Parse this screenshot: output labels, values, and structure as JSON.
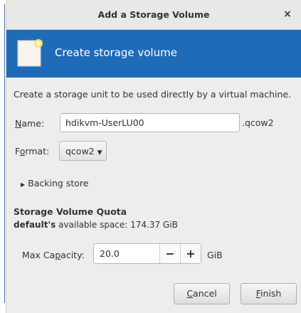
{
  "dialog": {
    "title": "Add a Storage Volume",
    "close_glyph": "×"
  },
  "banner": {
    "heading": "Create storage volume",
    "icon": "new-volume-icon",
    "color": "#1f6bb8"
  },
  "form": {
    "description": "Create a storage unit to be used directly by a virtual machine.",
    "name_label_pre": "",
    "name_label_u": "N",
    "name_label_post": "ame:",
    "name_value": "hdikvm-UserLU00",
    "name_suffix": ".qcow2",
    "format_label_pre": "F",
    "format_label_u": "o",
    "format_label_post": "rmat:",
    "format_value": "qcow2",
    "backing_store_label": "Backing store"
  },
  "quota": {
    "title": "Storage Volume Quota",
    "pool": "default's",
    "available_text": "available space: 174.37 GiB",
    "max_capacity_label_pre": "Max Ca",
    "max_capacity_label_u": "p",
    "max_capacity_label_post": "acity:",
    "max_capacity_value": "20.0",
    "decrement": "−",
    "increment": "+",
    "unit": "GiB"
  },
  "buttons": {
    "cancel_u": "C",
    "cancel_rest": "ancel",
    "finish_u": "F",
    "finish_rest": "inish"
  }
}
